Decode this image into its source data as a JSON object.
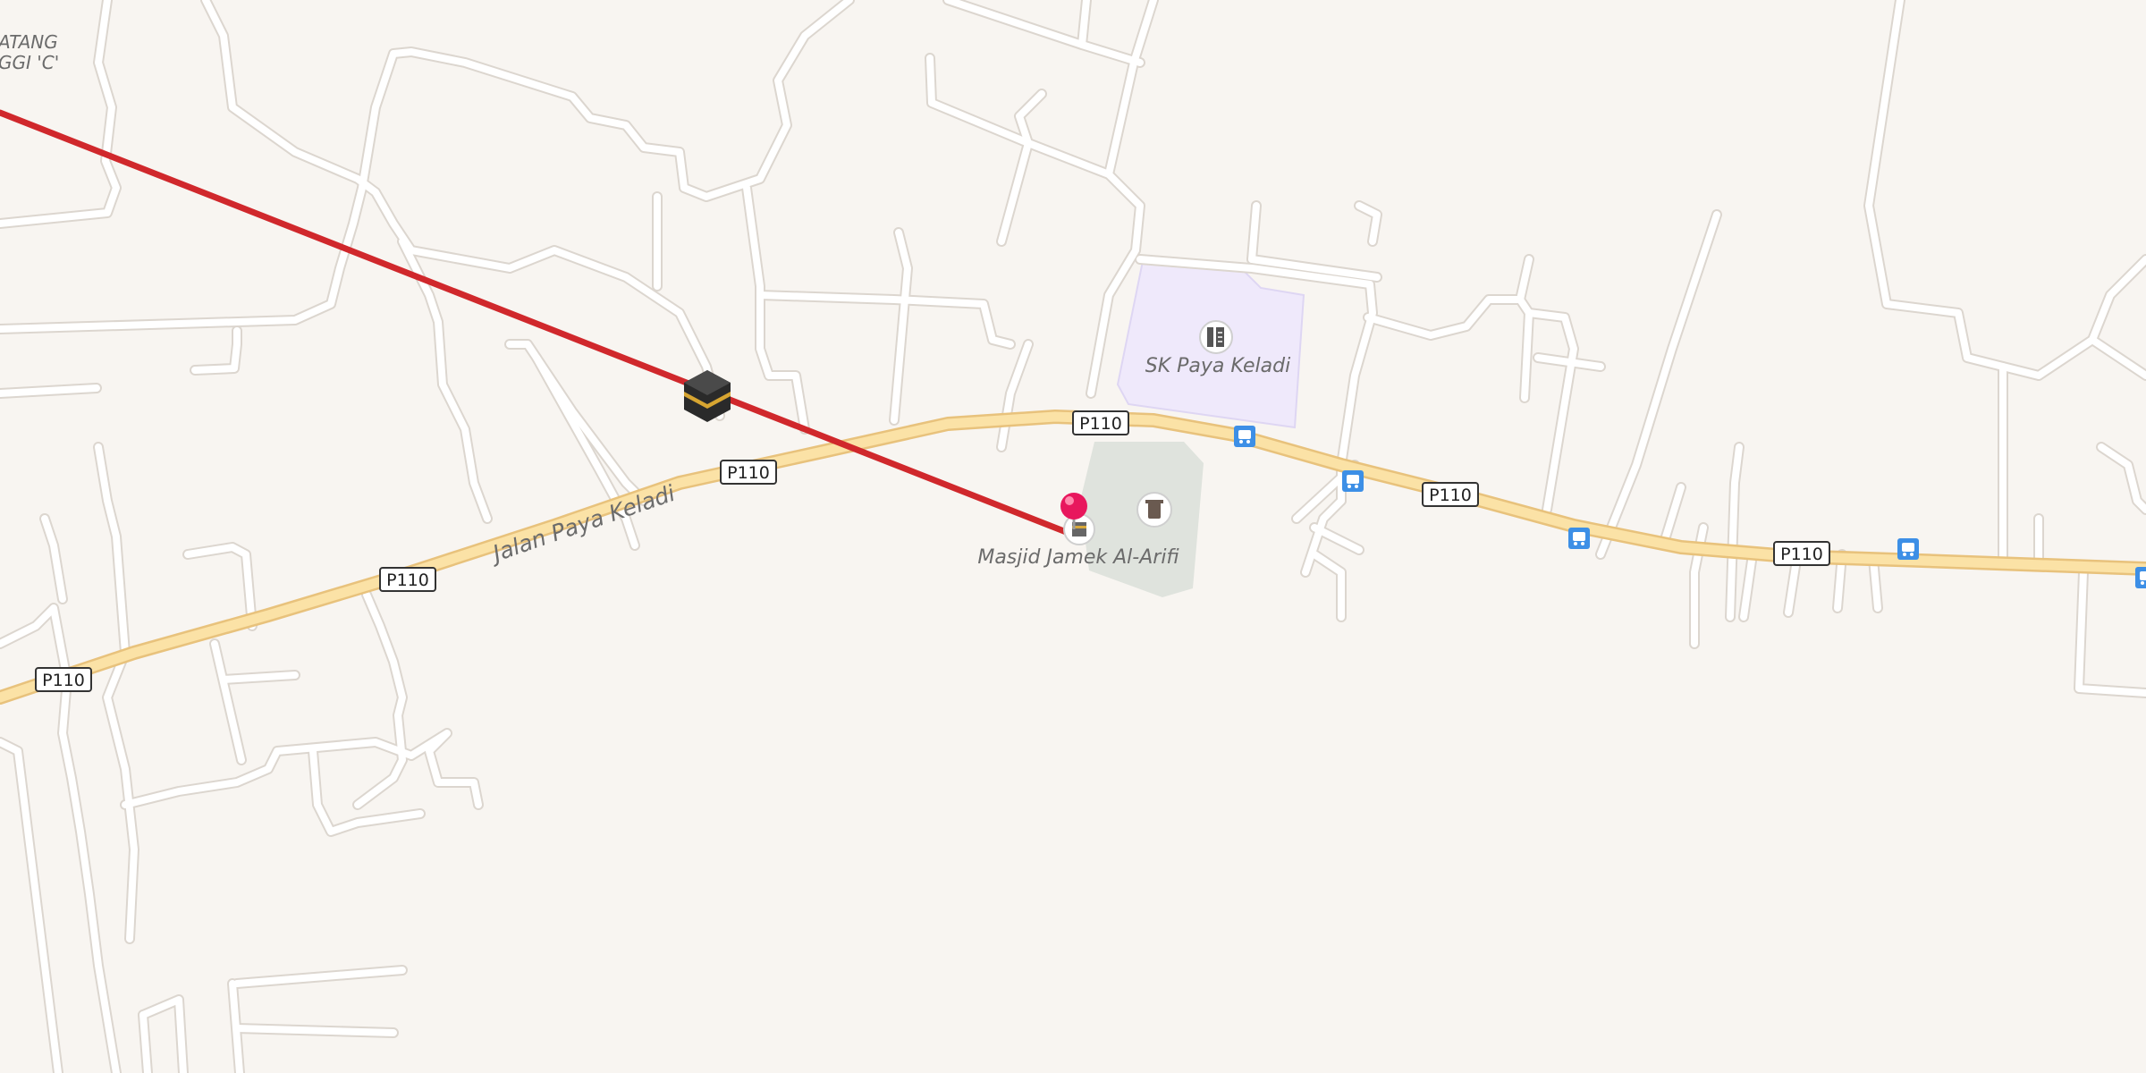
{
  "map": {
    "route_number": "P110",
    "road_name": "Jalan Paya Keladi",
    "places": {
      "school": "SK Paya Keladi",
      "mosque": "Masjid Jamek Al-Arifi",
      "area_line1": "ATANG",
      "area_line2": "GGI 'C'"
    },
    "icons": {
      "kaaba": "kaaba-icon",
      "location_pin": "map-pin-icon",
      "school": "school-icon",
      "mosque": "mosque-icon",
      "cemetery": "cemetery-icon",
      "bus_stop": "bus-stop-icon"
    },
    "colors": {
      "background": "#f8f5f1",
      "main_road": "#fbe2a6",
      "main_road_casing": "#e8c27c",
      "qibla_line": "#d0282c",
      "school_area": "#efe9fb",
      "cemetery_area": "#dfe3dd",
      "pin": "#e8175d",
      "bus_stop": "#3d8fe6"
    }
  }
}
